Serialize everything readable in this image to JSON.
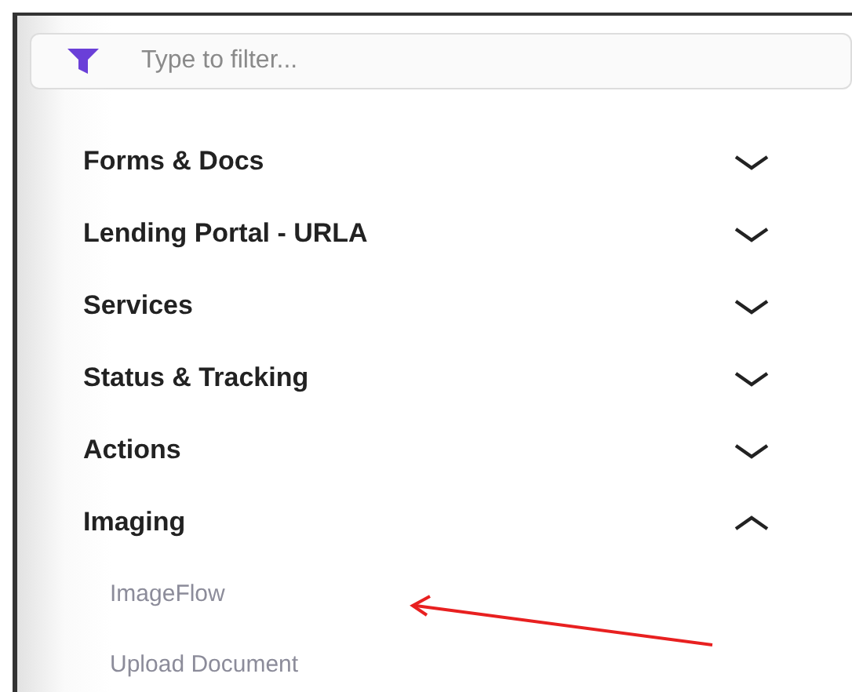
{
  "filter": {
    "placeholder": "Type to filter..."
  },
  "sections": [
    {
      "label": "Forms & Docs",
      "expanded": false
    },
    {
      "label": "Lending Portal - URLA",
      "expanded": false
    },
    {
      "label": "Services",
      "expanded": false
    },
    {
      "label": "Status & Tracking",
      "expanded": false
    },
    {
      "label": "Actions",
      "expanded": false
    },
    {
      "label": "Imaging",
      "expanded": true,
      "children": [
        {
          "label": "ImageFlow"
        },
        {
          "label": "Upload Document"
        }
      ]
    }
  ]
}
